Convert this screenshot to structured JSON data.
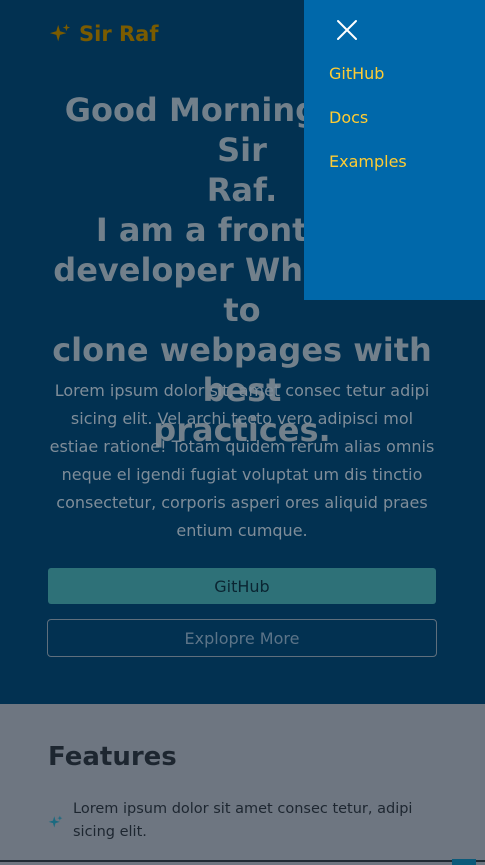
{
  "brand": {
    "name": "Sir Raf",
    "icon": "sparkles-icon",
    "color": "#7a5b00"
  },
  "hero": {
    "headline_lines": [
      "Good Morning. I am Sir",
      "Raf.",
      "I am a front-end",
      "developer Who loves to",
      "clone webpages with best",
      "practices."
    ],
    "lead": "Lorem ipsum dolor sit, amet consec tetur adipi sicing elit. Vel archi tecto vero adipisci mol estiae ratione! Totam quidem rerum alias omnis neque el igendi fugiat voluptat um dis tinctio consectetur, corporis asperi ores aliquid praes entium cumque.",
    "primary_button": "GitHub",
    "secondary_button": "Explopre More"
  },
  "features": {
    "title": "Features",
    "items": [
      {
        "icon": "sparkles-icon",
        "text": "Lorem ipsum dolor sit amet consec tetur, adipi sicing elit."
      }
    ]
  },
  "menu": {
    "close_icon": "close-icon",
    "links": [
      "GitHub",
      "Docs",
      "Examples"
    ],
    "background": "#0068aa",
    "link_color": "#ffcc33"
  }
}
